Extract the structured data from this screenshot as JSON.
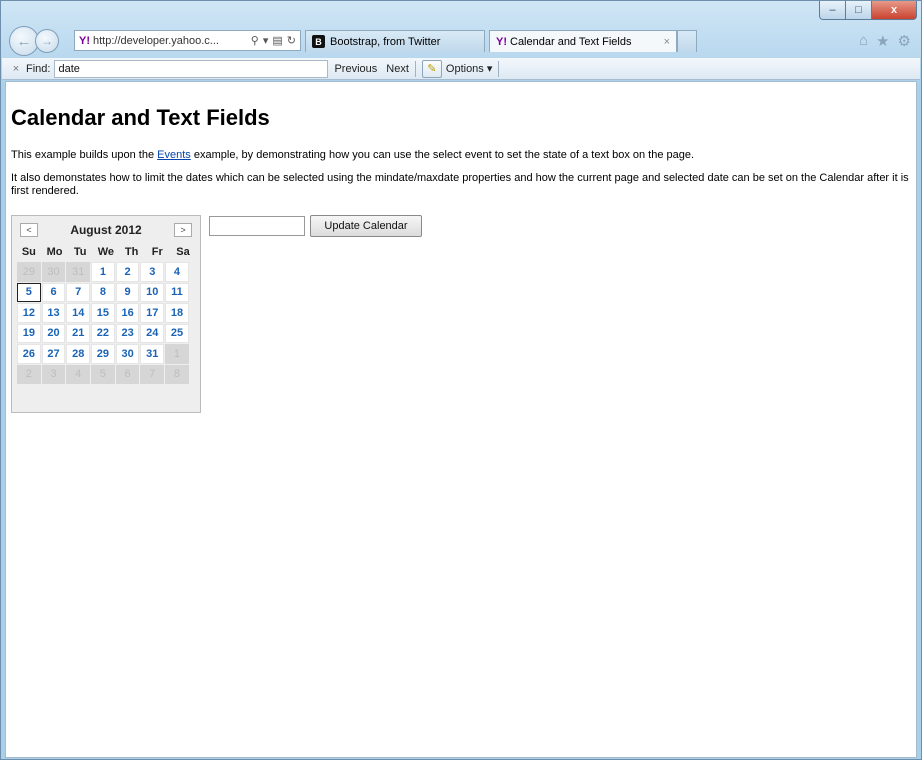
{
  "window": {
    "controls": {
      "minimize": "–",
      "maximize": "□",
      "close": "x"
    }
  },
  "toolbar": {
    "address": "http://developer.yahoo.c...",
    "address_icons": [
      "search-icon",
      "compat-icon",
      "refresh-icon"
    ],
    "tabs": [
      {
        "label": "Bootstrap, from Twitter",
        "icon": "B",
        "active": false
      },
      {
        "label": "Calendar and Text Fields",
        "icon": "Y!",
        "active": true
      }
    ],
    "right_icons": [
      "home-icon",
      "favorites-star-icon",
      "settings-gear-icon"
    ]
  },
  "find": {
    "label": "Find:",
    "value": "date",
    "previous": "Previous",
    "next": "Next",
    "options": "Options"
  },
  "page": {
    "title": "Calendar and Text Fields",
    "p1_before": "This example builds upon the ",
    "p1_link": "Events",
    "p1_after": " example, by demonstrating how you can use the select event to set the state of a text box on the page.",
    "p2": "It also demonstates how to limit the dates which can be selected using the mindate/maxdate properties and how the current page and selected date can be set on the Calendar after it is first rendered.",
    "update_button": "Update Calendar",
    "date_input_value": ""
  },
  "calendar": {
    "title": "August 2012",
    "prev": "<",
    "next": ">",
    "weekdays": [
      "Su",
      "Mo",
      "Tu",
      "We",
      "Th",
      "Fr",
      "Sa"
    ],
    "selected": "5",
    "days": [
      {
        "d": "29",
        "other": true
      },
      {
        "d": "30",
        "other": true
      },
      {
        "d": "31",
        "other": true
      },
      {
        "d": "1"
      },
      {
        "d": "2"
      },
      {
        "d": "3"
      },
      {
        "d": "4"
      },
      {
        "d": "5"
      },
      {
        "d": "6"
      },
      {
        "d": "7"
      },
      {
        "d": "8"
      },
      {
        "d": "9"
      },
      {
        "d": "10"
      },
      {
        "d": "11"
      },
      {
        "d": "12"
      },
      {
        "d": "13"
      },
      {
        "d": "14"
      },
      {
        "d": "15"
      },
      {
        "d": "16"
      },
      {
        "d": "17"
      },
      {
        "d": "18"
      },
      {
        "d": "19"
      },
      {
        "d": "20"
      },
      {
        "d": "21"
      },
      {
        "d": "22"
      },
      {
        "d": "23"
      },
      {
        "d": "24"
      },
      {
        "d": "25"
      },
      {
        "d": "26"
      },
      {
        "d": "27"
      },
      {
        "d": "28"
      },
      {
        "d": "29"
      },
      {
        "d": "30"
      },
      {
        "d": "31"
      },
      {
        "d": "1",
        "other": true
      },
      {
        "d": "2",
        "other": true
      },
      {
        "d": "3",
        "other": true
      },
      {
        "d": "4",
        "other": true
      },
      {
        "d": "5",
        "other": true
      },
      {
        "d": "6",
        "other": true
      },
      {
        "d": "7",
        "other": true
      },
      {
        "d": "8",
        "other": true
      }
    ]
  }
}
